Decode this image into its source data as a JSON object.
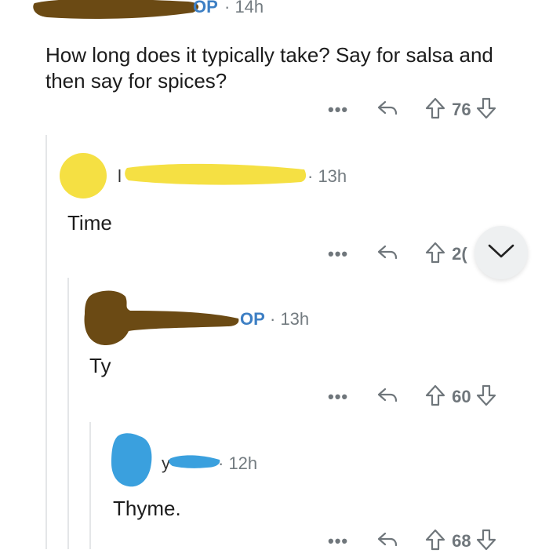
{
  "colors": {
    "op_blue": "#3d7fc4",
    "meta_gray": "#737b80",
    "redact_brown": "#6b4a14",
    "redact_yellow": "#f5e043",
    "redact_blue": "#3aa0de"
  },
  "top_comment": {
    "op_badge": "OP",
    "time": "· 14h",
    "body": "How long does it typically take? Say for salsa and then say for spices?",
    "dots": "•••",
    "votes": "76"
  },
  "reply1": {
    "username_prefix": "l",
    "time": "· 13h",
    "body": "Time",
    "dots": "•••",
    "votes": "2("
  },
  "reply2": {
    "op_badge": "OP",
    "time": "· 13h",
    "body": "Ty",
    "dots": "•••",
    "votes": "60"
  },
  "reply3": {
    "username_prefix": "y",
    "time": "· 12h",
    "body": "Thyme.",
    "dots": "•••",
    "votes": "68"
  },
  "icons": {
    "reply": "reply-arrow-icon",
    "upvote": "upvote-arrow-icon",
    "downvote": "downvote-arrow-icon",
    "collapse": "chevron-down-icon"
  }
}
